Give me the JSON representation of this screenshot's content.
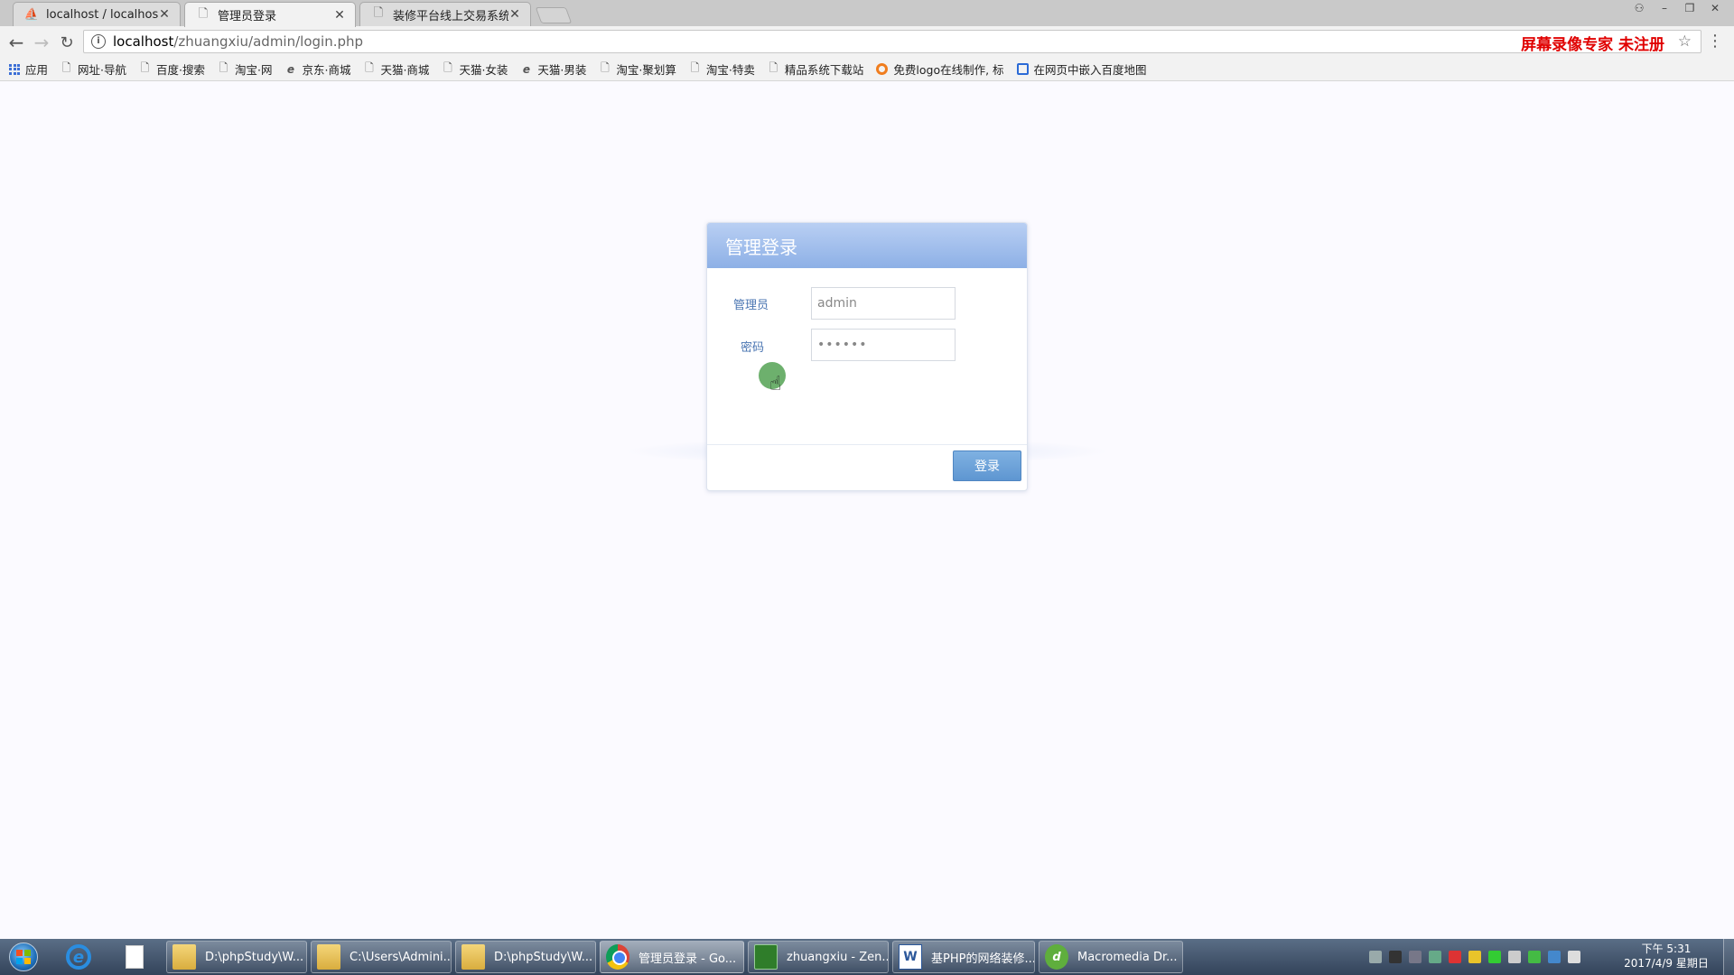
{
  "browser": {
    "tabs": [
      {
        "title": "localhost / localhost / i",
        "icon": "phpmyadmin-icon"
      },
      {
        "title": "管理员登录",
        "icon": "page-icon"
      },
      {
        "title": "装修平台线上交易系统",
        "icon": "page-icon"
      }
    ],
    "url_host": "localhost",
    "url_path": "/zhuangxiu/admin/login.php",
    "recorder_badge": "屏幕录像专家 未注册",
    "bookmarks": [
      {
        "label": "应用",
        "icon": "apps-icon"
      },
      {
        "label": "网址·导航",
        "icon": "page-icon"
      },
      {
        "label": "百度·搜索",
        "icon": "page-icon"
      },
      {
        "label": "淘宝·网",
        "icon": "page-icon"
      },
      {
        "label": "京东·商城",
        "icon": "ie-icon"
      },
      {
        "label": "天猫·商城",
        "icon": "page-icon"
      },
      {
        "label": "天猫·女装",
        "icon": "page-icon"
      },
      {
        "label": "天猫·男装",
        "icon": "ie-icon"
      },
      {
        "label": "淘宝·聚划算",
        "icon": "page-icon"
      },
      {
        "label": "淘宝·特卖",
        "icon": "page-icon"
      },
      {
        "label": "精品系统下载站",
        "icon": "page-icon"
      },
      {
        "label": "免费logo在线制作, 标",
        "icon": "orange-circle-icon"
      },
      {
        "label": "在网页中嵌入百度地图",
        "icon": "blue-box-icon"
      }
    ]
  },
  "login": {
    "header": "管理登录",
    "username_label": "管理员",
    "username_value": "admin",
    "password_label": "密码",
    "password_value": "••••••",
    "submit_label": "登录"
  },
  "taskbar": {
    "tasks": [
      {
        "label": "D:\\phpStudy\\W...",
        "icon": "folder-icon"
      },
      {
        "label": "C:\\Users\\Admini...",
        "icon": "folder-icon"
      },
      {
        "label": "D:\\phpStudy\\W...",
        "icon": "folder-icon"
      },
      {
        "label": "管理员登录 - Go...",
        "icon": "chrome-icon"
      },
      {
        "label": "zhuangxiu - Zen...",
        "icon": "zend-icon"
      },
      {
        "label": "基PHP的网络装修...",
        "icon": "word-icon"
      },
      {
        "label": "Macromedia Dr...",
        "icon": "dreamweaver-icon"
      }
    ],
    "clock_time": "下午 5:31",
    "clock_date": "2017/4/9 星期日"
  },
  "colors": {
    "header_gradient_top": "#b9cff3",
    "header_gradient_bottom": "#8db0e6",
    "label_color": "#4a75b2",
    "button_color": "#5e96d1",
    "recorder_red": "#e00000"
  }
}
